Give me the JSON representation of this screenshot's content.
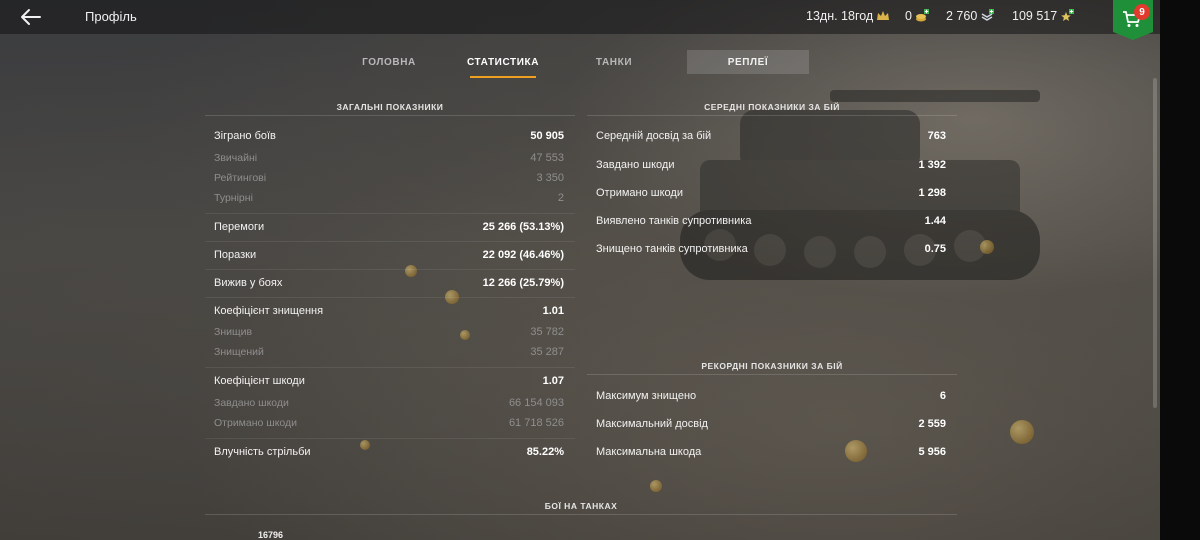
{
  "header": {
    "title": "Профіль",
    "premium_time": "13дн. 18год",
    "gold": "0",
    "free_xp": "2 760",
    "credits": "109 517",
    "cart_badge": "9",
    "colors": {
      "cart_green": "#1f8f3a",
      "badge_red": "#e23b2e",
      "tab_accent": "#f0a020"
    }
  },
  "tabs": [
    {
      "label": "ГОЛОВНА"
    },
    {
      "label": "СТАТИСТИКА"
    },
    {
      "label": "ТАНКИ"
    },
    {
      "label": "РЕПЛЕЇ"
    }
  ],
  "general": {
    "title": "ЗАГАЛЬНІ ПОКАЗНИКИ",
    "rows": [
      {
        "label": "Зіграно боїв",
        "value": "50 905"
      },
      {
        "label": "Звичайні",
        "value": "47 553"
      },
      {
        "label": "Рейтингові",
        "value": "3 350"
      },
      {
        "label": "Турнірні",
        "value": "2"
      },
      {
        "label": "Перемоги",
        "value": "25 266 (53.13%)"
      },
      {
        "label": "Поразки",
        "value": "22 092 (46.46%)"
      },
      {
        "label": "Вижив у боях",
        "value": "12 266 (25.79%)"
      },
      {
        "label": "Коефіцієнт знищення",
        "value": "1.01"
      },
      {
        "label": "Знищив",
        "value": "35 782"
      },
      {
        "label": "Знищений",
        "value": "35 287"
      },
      {
        "label": "Коефіцієнт шкоди",
        "value": "1.07"
      },
      {
        "label": "Завдано шкоди",
        "value": "66 154 093"
      },
      {
        "label": "Отримано шкоди",
        "value": "61 718 526"
      },
      {
        "label": "Влучність стрільби",
        "value": "85.22%"
      }
    ]
  },
  "average": {
    "title": "СЕРЕДНІ ПОКАЗНИКИ ЗА БІЙ",
    "rows": [
      {
        "label": "Середній досвід за бій",
        "value": "763"
      },
      {
        "label": "Завдано шкоди",
        "value": "1 392"
      },
      {
        "label": "Отримано шкоди",
        "value": "1 298"
      },
      {
        "label": "Виявлено танків супротивника",
        "value": "1.44"
      },
      {
        "label": "Знищено танків супротивника",
        "value": "0.75"
      }
    ]
  },
  "records": {
    "title": "РЕКОРДНІ ПОКАЗНИКИ ЗА БІЙ",
    "rows": [
      {
        "label": "Максимум знищено",
        "value": "6"
      },
      {
        "label": "Максимальний досвід",
        "value": "2 559"
      },
      {
        "label": "Максимальна шкода",
        "value": "5 956"
      }
    ]
  },
  "tank_battles": {
    "title": "БОЇ НА ТАНКАХ",
    "first_value": "16796"
  }
}
